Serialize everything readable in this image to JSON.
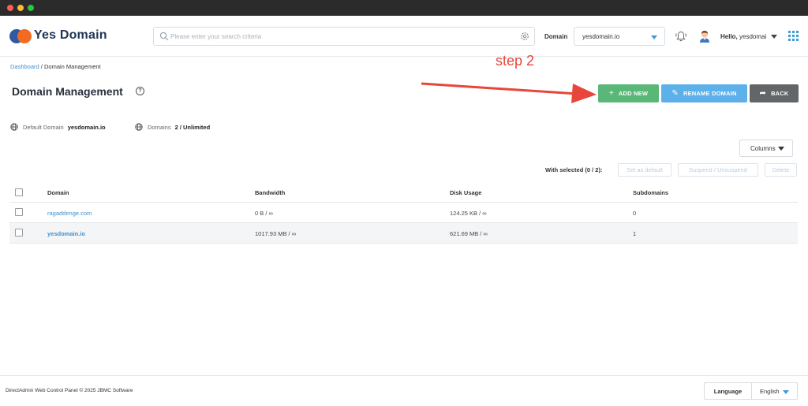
{
  "app": {
    "brand": "Yes Domain",
    "colors": {
      "accent": "#3f9ad6",
      "brand_dark": "#1f3556",
      "brand_orange": "#f26b21",
      "success": "#59b877",
      "info": "#5db1ea",
      "neutral": "#636669",
      "annotation": "#e8463b"
    }
  },
  "header": {
    "search_placeholder": "Please enter your search criteria",
    "domain_label": "Domain",
    "domain_selected": "yesdomain.io",
    "greeting": "Hello,",
    "username": "yesdomai",
    "icons": [
      "search-icon",
      "settings-gear-icon",
      "chevron-down-icon",
      "bell-icon",
      "user-avatar",
      "apps-grid-icon"
    ]
  },
  "breadcrumb": {
    "root": "Dashboard",
    "separator": "/",
    "current": "Domain Management"
  },
  "page": {
    "title": "Domain Management",
    "help_symbol": "?"
  },
  "annotation": {
    "text": "step 2"
  },
  "actions": {
    "add_new": "ADD NEW",
    "rename": "RENAME DOMAIN",
    "back": "BACK",
    "add_icon": "+",
    "rename_icon": "✎",
    "back_icon": "➦"
  },
  "summary": {
    "default_domain_label": "Default Domain",
    "default_domain_value": "yesdomain.io",
    "domains_label": "Domains",
    "domains_value": "2 / Unlimited"
  },
  "toolbar": {
    "columns_label": "Columns",
    "with_selected": "With selected (0 / 2):",
    "set_default": "Set as default",
    "suspend": "Suspend / Unsuspend",
    "delete": "Delete"
  },
  "table": {
    "headers": {
      "domain": "Domain",
      "bandwidth": "Bandwidth",
      "disk": "Disk Usage",
      "subdomains": "Subdomains"
    },
    "rows": [
      {
        "domain": "ragaddenge.com",
        "bandwidth": "0 B / ∞",
        "disk": "124.25 KB / ∞",
        "subdomains": "0"
      },
      {
        "domain": "yesdomain.io",
        "bandwidth": "1017.93 MB / ∞",
        "disk": "621.69 MB / ∞",
        "subdomains": "1"
      }
    ]
  },
  "footer": {
    "copyright": "DirectAdmin Web Control Panel © 2025 JBMC Software",
    "language_label": "Language",
    "language_value": "English"
  }
}
